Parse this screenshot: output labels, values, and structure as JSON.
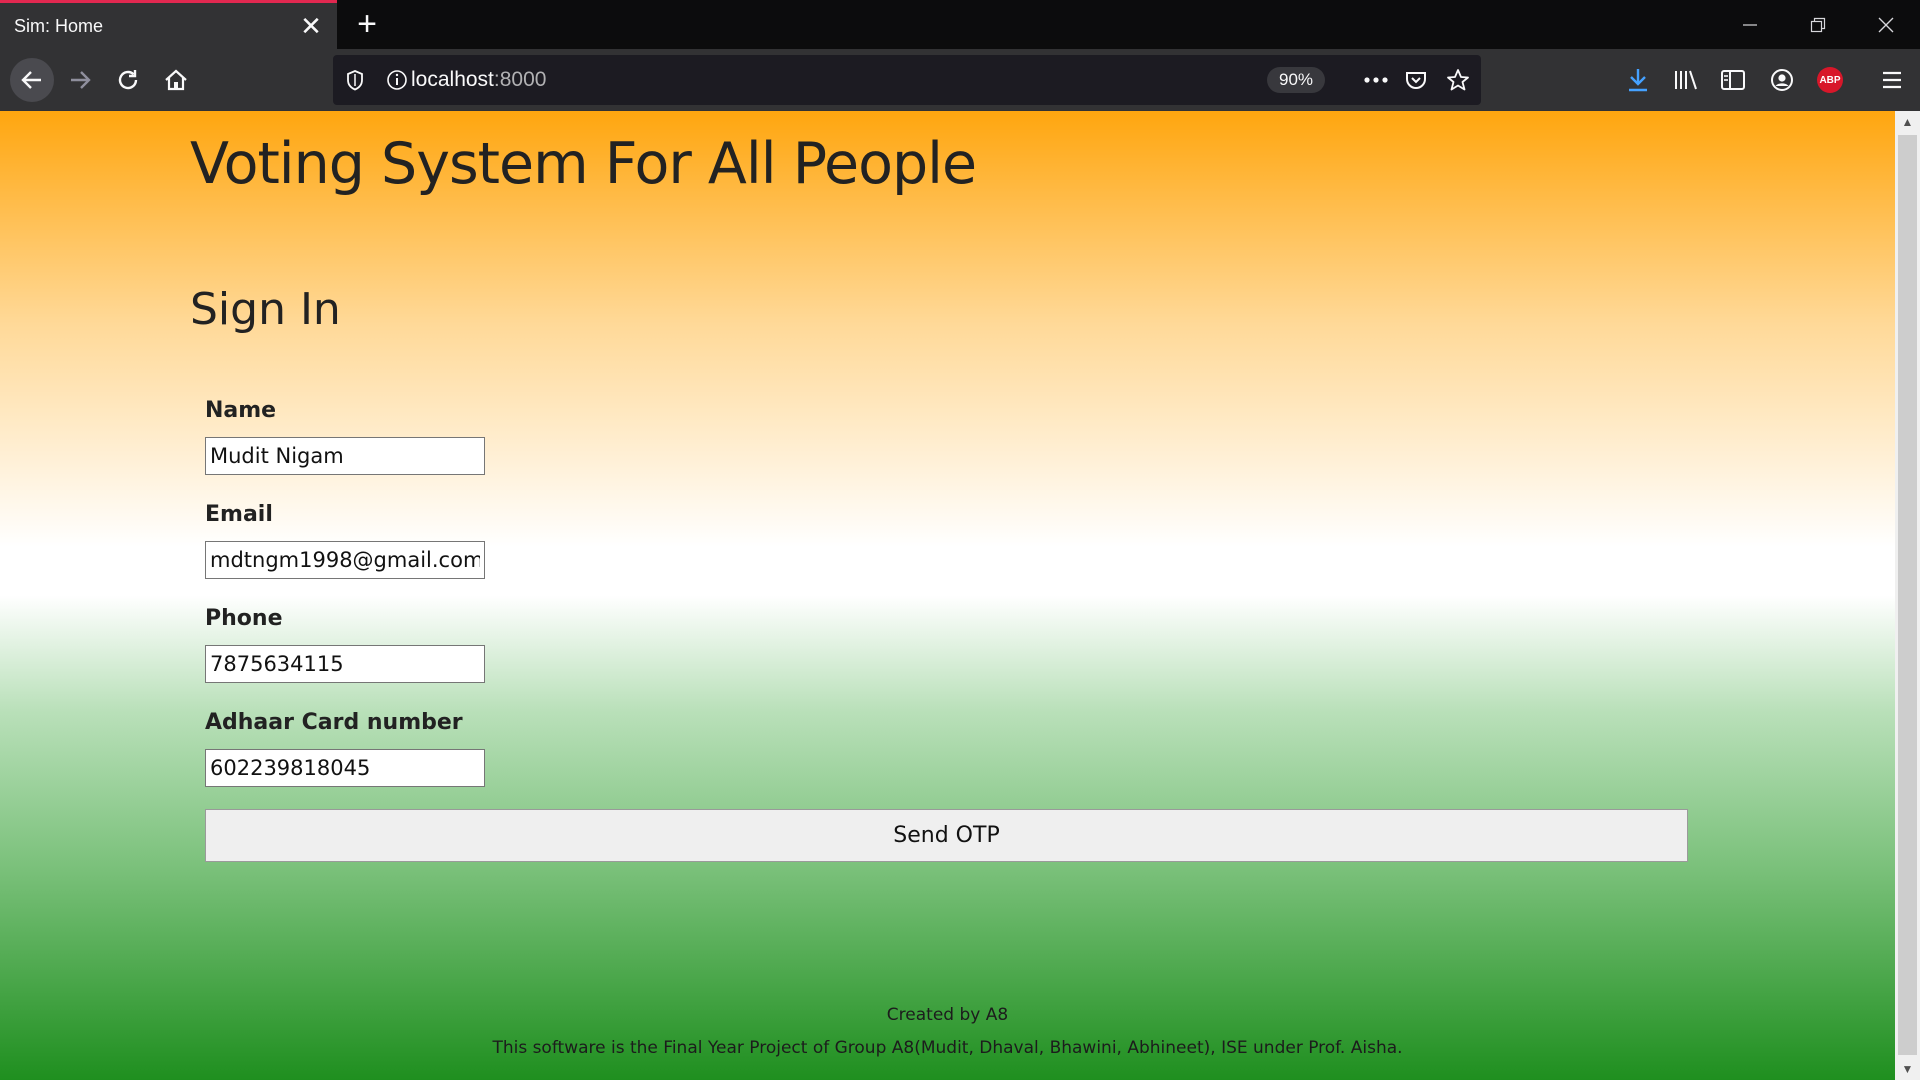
{
  "browser": {
    "tab_title": "Sim: Home",
    "url_host": "localhost",
    "url_port": ":8000",
    "zoom": "90%",
    "abp_label": "ABP"
  },
  "page": {
    "site_title": "Voting System For All People",
    "signin_heading": "Sign In",
    "fields": [
      {
        "label": "Name",
        "value": "Mudit Nigam"
      },
      {
        "label": "Email",
        "value": "mdtngm1998@gmail.com"
      },
      {
        "label": "Phone",
        "value": "7875634115"
      },
      {
        "label": "Adhaar Card number",
        "value": "602239818045"
      }
    ],
    "submit_label": "Send OTP",
    "footer_created": "Created by A8",
    "footer_note": "This software is the Final Year Project of Group A8(Mudit, Dhaval, Bhawini, Abhineet), ISE under Prof. Aisha."
  },
  "colors": {
    "saffron": "#ffa60f",
    "white": "#ffffff",
    "green": "#1f8f1f",
    "tab_accent": "#e22850"
  }
}
